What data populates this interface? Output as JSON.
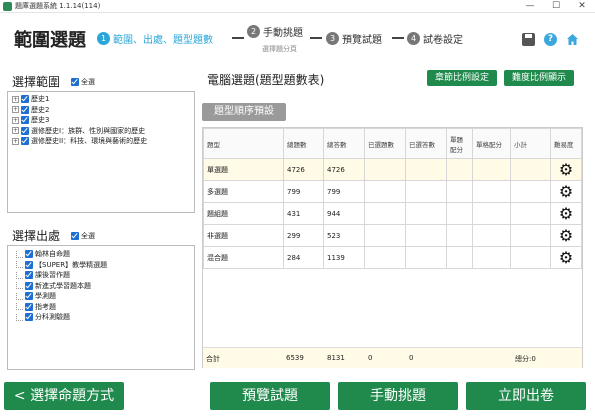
{
  "window": {
    "title": "題庫選題系統 1.1.14(114)",
    "minimize": "—",
    "maximize": "☐",
    "close": "✕"
  },
  "header": {
    "page_title": "範圍選題",
    "steps": [
      {
        "num": "1",
        "label": "範圍、出處、題型題數"
      },
      {
        "num": "2",
        "label": "手動挑題",
        "sub": "選擇題分頁"
      },
      {
        "num": "3",
        "label": "預覽試題"
      },
      {
        "num": "4",
        "label": "試卷設定"
      }
    ],
    "help_label": "?"
  },
  "scope": {
    "label": "選擇範圍",
    "all_label": "全選",
    "items": [
      "歷史1",
      "歷史2",
      "歷史3",
      "選修歷史I：族群、性別與國家的歷史",
      "選修歷史II：科技、環境與藝術的歷史"
    ]
  },
  "source": {
    "label": "選擇出處",
    "all_label": "全選",
    "items": [
      "翰林自命題",
      "【SUPER】教學精選題",
      "課後習作題",
      "新進式學習題本題",
      "學測題",
      "指考題",
      "分科測驗題"
    ]
  },
  "main": {
    "title": "電腦選題(題型題數表)",
    "chapter_ratio_btn": "章節比例設定",
    "difficulty_ratio_btn": "難度比例顯示",
    "preset_btn": "題型順序預設",
    "columns": [
      "題型",
      "總題數",
      "總答數",
      "已選題數",
      "已選答數",
      "單題配分",
      "單格配分",
      "小計",
      "難易度"
    ],
    "rows": [
      {
        "type": "單選題",
        "total_q": "4726",
        "total_a": "4726"
      },
      {
        "type": "多選題",
        "total_q": "799",
        "total_a": "799"
      },
      {
        "type": "題組題",
        "total_q": "431",
        "total_a": "944"
      },
      {
        "type": "非選題",
        "total_q": "299",
        "total_a": "523"
      },
      {
        "type": "混合題",
        "total_q": "284",
        "total_a": "1139"
      }
    ],
    "total": {
      "label": "合計",
      "total_q": "6539",
      "total_a": "8131",
      "sel_q": "0",
      "sel_a": "0",
      "score": "總分:0"
    }
  },
  "footer": {
    "back_btn": "< 選擇命題方式",
    "preview_btn": "預覽試題",
    "manual_btn": "手動挑題",
    "publish_btn": "立即出卷"
  }
}
